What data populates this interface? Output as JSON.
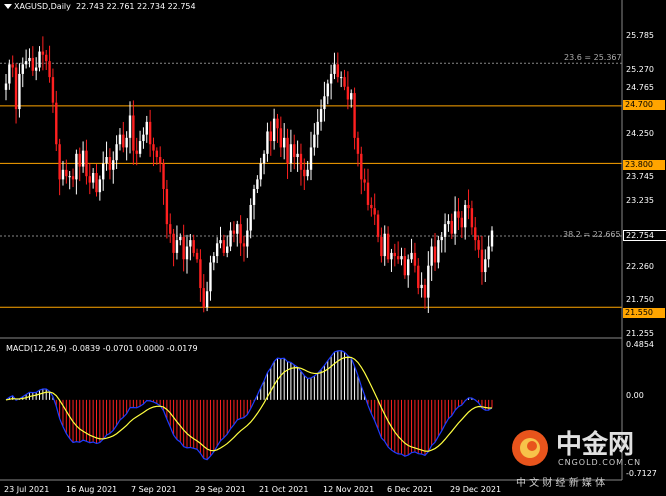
{
  "header": {
    "symbol_tf": "XAGUSD,Daily",
    "ohlc": "22.743 22.761 22.734 22.754"
  },
  "macd": {
    "label": "MACD(12,26,9) -0.0839 -0.0701 0.0000 -0.0179",
    "axis_top": "0.4854",
    "axis_zero": "0.00",
    "axis_bottom": "-0.7127"
  },
  "price_axis": [
    "25.785",
    "25.270",
    "24.765",
    "24.250",
    "23.745",
    "23.235",
    "22.260",
    "21.750",
    "21.255"
  ],
  "price_tags": [
    {
      "text": "24.700",
      "bg": "#ffa500",
      "fg": "#000"
    },
    {
      "text": "23.800",
      "bg": "#ffa500",
      "fg": "#000"
    },
    {
      "text": "22.754",
      "bg": "#000",
      "fg": "#fff"
    },
    {
      "text": "21.550",
      "bg": "#ffa500",
      "fg": "#000"
    }
  ],
  "fib_labels": {
    "top": "23.6 = 25.367",
    "mid": "38.2 = 22.665"
  },
  "time_axis": [
    "23 Jul 2021",
    "16 Aug 2021",
    "7 Sep 2021",
    "29 Sep 2021",
    "21 Oct 2021",
    "12 Nov 2021",
    "6 Dec 2021",
    "29 Dec 2021"
  ],
  "watermark": {
    "brand": "中金网",
    "domain": "CNGOLD.COM.CN",
    "slogan": "中 文 财 经 新 媒 体"
  },
  "colors": {
    "bull": "#ffffff",
    "bear": "#ff2020",
    "level": "#ffa500",
    "macd_main": "#1e3cff",
    "macd_signal": "#ffff40"
  },
  "chart_data": {
    "type": "candlestick",
    "close": [
      25.05,
      25.35,
      25.3,
      24.65,
      25.2,
      25.35,
      25.4,
      25.45,
      25.25,
      25.3,
      25.55,
      25.5,
      25.4,
      25.15,
      24.75,
      24.1,
      23.55,
      23.7,
      23.6,
      23.6,
      23.55,
      23.95,
      23.75,
      24.0,
      23.6,
      23.5,
      23.65,
      23.35,
      23.55,
      23.8,
      23.9,
      23.7,
      23.85,
      24.1,
      24.25,
      24.05,
      24.2,
      24.55,
      24.0,
      23.95,
      24.15,
      24.25,
      24.45,
      24.1,
      24.0,
      23.9,
      23.8,
      23.4,
      22.85,
      22.7,
      22.4,
      22.6,
      22.65,
      22.3,
      22.5,
      22.6,
      22.4,
      22.3,
      21.85,
      21.55,
      21.8,
      22.25,
      22.35,
      22.55,
      22.6,
      22.4,
      22.5,
      22.75,
      22.7,
      22.85,
      22.55,
      22.5,
      22.75,
      23.15,
      23.4,
      23.55,
      23.8,
      23.95,
      24.3,
      24.15,
      24.5,
      24.35,
      24.05,
      24.2,
      23.8,
      24.1,
      23.9,
      23.95,
      23.7,
      23.6,
      23.7,
      24.05,
      24.25,
      24.45,
      24.65,
      24.85,
      25.05,
      25.2,
      25.35,
      25.15,
      25.15,
      25.0,
      24.8,
      24.9,
      24.2,
      23.95,
      23.55,
      23.5,
      23.15,
      23.1,
      23.0,
      22.65,
      22.35,
      22.7,
      22.3,
      22.4,
      22.35,
      22.3,
      22.35,
      22.05,
      22.3,
      22.4,
      22.2,
      21.85,
      21.9,
      21.7,
      22.2,
      22.5,
      22.25,
      22.6,
      22.65,
      22.85,
      22.9,
      22.7,
      23.05,
      22.95,
      22.8,
      23.15,
      23.1,
      22.8,
      22.6,
      22.45,
      22.1,
      22.3,
      22.5,
      22.75
    ]
  }
}
